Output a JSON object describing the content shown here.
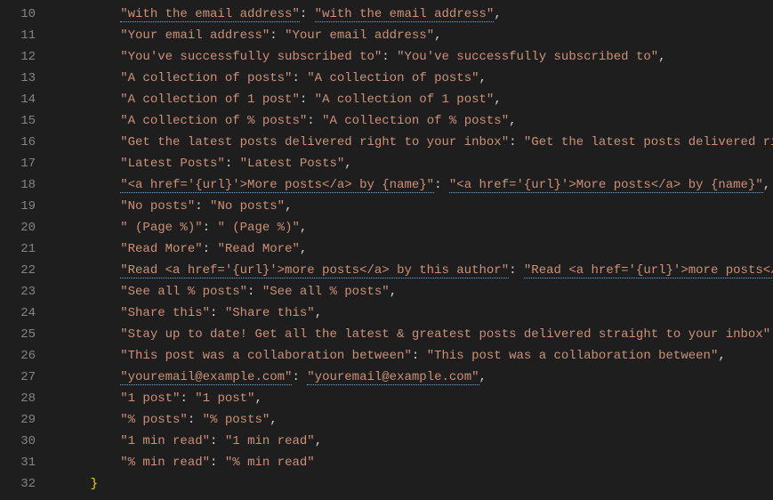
{
  "indent": "        ",
  "closing_indent": "    ",
  "lines": [
    {
      "n": 10,
      "k": "\"with the email address\"",
      "v": "\"with the email address\"",
      "spell_k": true,
      "spell_v": true,
      "comma": true
    },
    {
      "n": 11,
      "k": "\"Your email address\"",
      "v": "\"Your email address\"",
      "spell_k": false,
      "spell_v": false,
      "comma": true
    },
    {
      "n": 12,
      "k": "\"You've successfully subscribed to\"",
      "v": "\"You've successfully subscribed to\"",
      "spell_k": false,
      "spell_v": false,
      "comma": true
    },
    {
      "n": 13,
      "k": "\"A collection of posts\"",
      "v": "\"A collection of posts\"",
      "spell_k": false,
      "spell_v": false,
      "comma": true
    },
    {
      "n": 14,
      "k": "\"A collection of 1 post\"",
      "v": "\"A collection of 1 post\"",
      "spell_k": false,
      "spell_v": false,
      "comma": true
    },
    {
      "n": 15,
      "k": "\"A collection of % posts\"",
      "v": "\"A collection of % posts\"",
      "spell_k": false,
      "spell_v": false,
      "comma": true
    },
    {
      "n": 16,
      "k": "\"Get the latest posts delivered right to your inbox\"",
      "v": "\"Get the latest posts delivered right to your inbox\"",
      "spell_k": false,
      "spell_v": false,
      "comma": true
    },
    {
      "n": 17,
      "k": "\"Latest Posts\"",
      "v": "\"Latest Posts\"",
      "spell_k": false,
      "spell_v": false,
      "comma": true
    },
    {
      "n": 18,
      "k": "\"<a href='{url}'>More posts</a> by {name}\"",
      "v": "\"<a href='{url}'>More posts</a> by {name}\"",
      "spell_k": true,
      "spell_v": true,
      "comma": true
    },
    {
      "n": 19,
      "k": "\"No posts\"",
      "v": "\"No posts\"",
      "spell_k": false,
      "spell_v": false,
      "comma": true
    },
    {
      "n": 20,
      "k": "\" (Page %)\"",
      "v": "\" (Page %)\"",
      "spell_k": false,
      "spell_v": false,
      "comma": true
    },
    {
      "n": 21,
      "k": "\"Read More\"",
      "v": "\"Read More\"",
      "spell_k": false,
      "spell_v": false,
      "comma": true
    },
    {
      "n": 22,
      "k": "\"Read <a href='{url}'>more posts</a> by this author\"",
      "v": "\"Read <a href='{url}'>more posts</a> by this author\"",
      "spell_k": true,
      "spell_v": true,
      "comma": true
    },
    {
      "n": 23,
      "k": "\"See all % posts\"",
      "v": "\"See all % posts\"",
      "spell_k": false,
      "spell_v": false,
      "comma": true
    },
    {
      "n": 24,
      "k": "\"Share this\"",
      "v": "\"Share this\"",
      "spell_k": false,
      "spell_v": false,
      "comma": true
    },
    {
      "n": 25,
      "k": "\"Stay up to date! Get all the latest & greatest posts delivered straight to your inbox\"",
      "v": "\"Stay up to date! Get all the latest & greatest posts delivered straight to your inbox\"",
      "spell_k": false,
      "spell_v": false,
      "comma": true
    },
    {
      "n": 26,
      "k": "\"This post was a collaboration between\"",
      "v": "\"This post was a collaboration between\"",
      "spell_k": false,
      "spell_v": false,
      "comma": true
    },
    {
      "n": 27,
      "k": "\"youremail@example.com\"",
      "v": "\"youremail@example.com\"",
      "spell_k": true,
      "spell_v": true,
      "comma": true
    },
    {
      "n": 28,
      "k": "\"1 post\"",
      "v": "\"1 post\"",
      "spell_k": false,
      "spell_v": false,
      "comma": true
    },
    {
      "n": 29,
      "k": "\"% posts\"",
      "v": "\"% posts\"",
      "spell_k": false,
      "spell_v": false,
      "comma": true
    },
    {
      "n": 30,
      "k": "\"1 min read\"",
      "v": "\"1 min read\"",
      "spell_k": false,
      "spell_v": false,
      "comma": true
    },
    {
      "n": 31,
      "k": "\"% min read\"",
      "v": "\"% min read\"",
      "spell_k": false,
      "spell_v": false,
      "comma": false
    }
  ],
  "closing": {
    "n": 32,
    "text": "}"
  }
}
